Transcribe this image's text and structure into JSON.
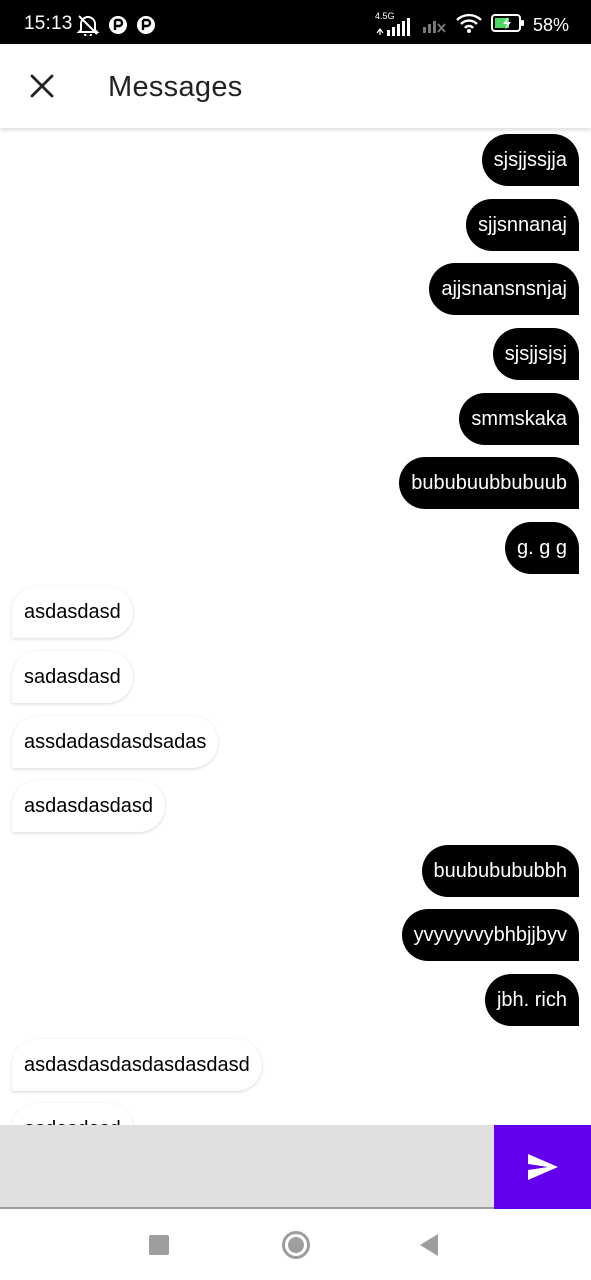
{
  "status_bar": {
    "time": "15:13",
    "network_label": "4.5G",
    "battery_percent": "58%",
    "icons": [
      "mute-bell-icon",
      "app-notification-icon",
      "app-notification-icon",
      "signal-icon",
      "no-signal-icon",
      "wifi-icon",
      "battery-charging-icon"
    ]
  },
  "header": {
    "title": "Messages",
    "close_icon": "close-icon"
  },
  "messages": [
    {
      "text": "sjsjjssjja",
      "side": "sent"
    },
    {
      "text": "sjjsnnanaj",
      "side": "sent"
    },
    {
      "text": "ajjsnansnsnjaj",
      "side": "sent"
    },
    {
      "text": "sjsjjsjsj",
      "side": "sent"
    },
    {
      "text": "smmskaka",
      "side": "sent"
    },
    {
      "text": "bububuubbubuub",
      "side": "sent"
    },
    {
      "text": "g. g g",
      "side": "sent"
    },
    {
      "text": "asdasdasd",
      "side": "received"
    },
    {
      "text": "sadasdasd",
      "side": "received"
    },
    {
      "text": "assdadasdasdsadas",
      "side": "received"
    },
    {
      "text": "asdasdasdasd",
      "side": "received"
    },
    {
      "text": "buububububbh",
      "side": "sent"
    },
    {
      "text": "yvyvyvvybhbjjbyv",
      "side": "sent"
    },
    {
      "text": "jbh. rich",
      "side": "sent"
    },
    {
      "text": "asdasdasdasdasdasdasd",
      "side": "received"
    },
    {
      "text": "asdasdasd",
      "side": "received"
    }
  ],
  "composer": {
    "value": "",
    "placeholder": "",
    "send_icon": "send-icon"
  },
  "colors": {
    "sent_bubble": "#000000",
    "received_bubble": "#ffffff",
    "send_button": "#6200ee",
    "status_bar": "#000000"
  },
  "nav_bar": {
    "icons": [
      "recent-apps-icon",
      "home-icon",
      "back-icon"
    ]
  }
}
